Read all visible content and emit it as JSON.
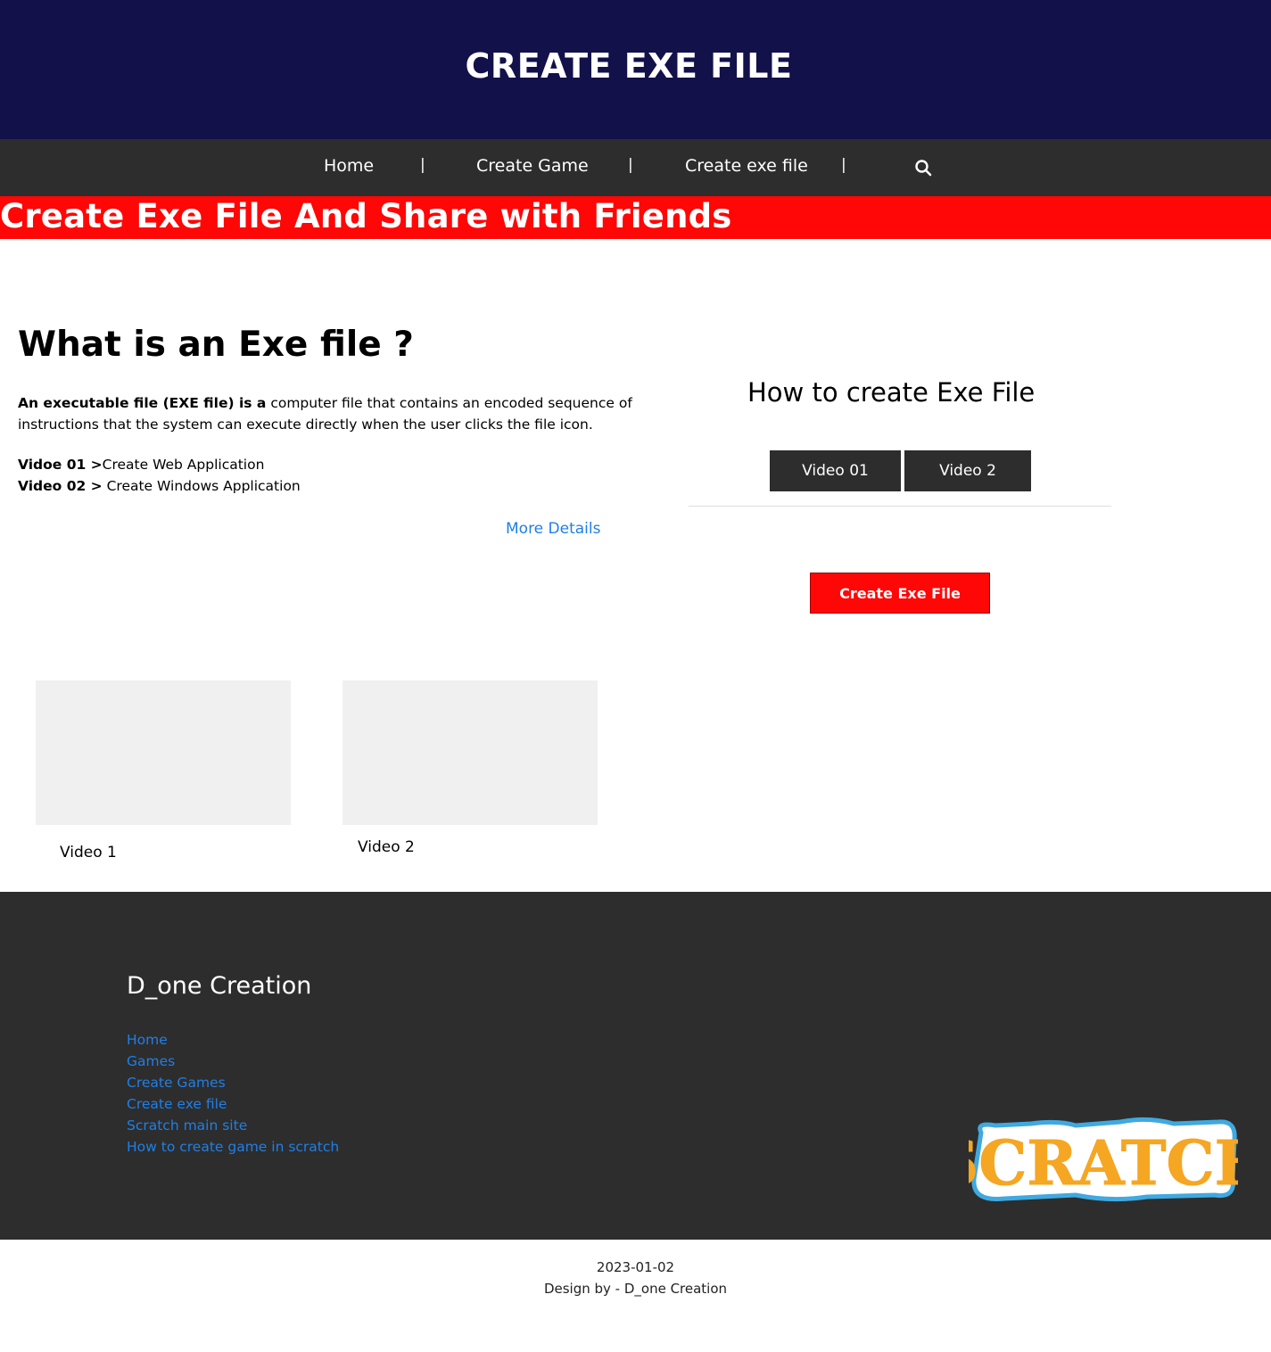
{
  "header": {
    "title": "CREATE EXE FILE",
    "bg_color": "#13114a"
  },
  "nav": {
    "items": [
      {
        "label": "Home"
      },
      {
        "label": "Create Game"
      },
      {
        "label": "Create exe file"
      }
    ],
    "separator": "|",
    "search_icon": "search-icon"
  },
  "banner": {
    "text": "Create Exe File And Share with Friends",
    "bg_color": "#ff0707"
  },
  "intro": {
    "heading": "What is an Exe file ?",
    "desc_bold": "An executable file (EXE file) is a",
    "desc_rest": "computer file that contains an encoded sequence of instructions that the system can execute directly when the user clicks the file icon.",
    "video1_label": "Vidoe 01 >",
    "video1_text": "Create Web Application",
    "video2_label": "Video 02 >",
    "video2_text": "Create Windows Application",
    "more_details": "More Details"
  },
  "howto": {
    "heading": "How to create Exe File",
    "tab1": "Video 01",
    "tab2": "Video 2",
    "create_button": "Create Exe File"
  },
  "videos": [
    {
      "label": "Video 1"
    },
    {
      "label": "Video 2"
    }
  ],
  "footer": {
    "brand": "D_one Creation",
    "links": [
      "Home",
      "Games",
      "Create Games",
      "Create exe file",
      "Scratch main site",
      "How to create game in scratch"
    ],
    "logo_text": "SCRATCH"
  },
  "copyright": {
    "date": "2023-01-02",
    "design": "Design by - D_one Creation"
  }
}
